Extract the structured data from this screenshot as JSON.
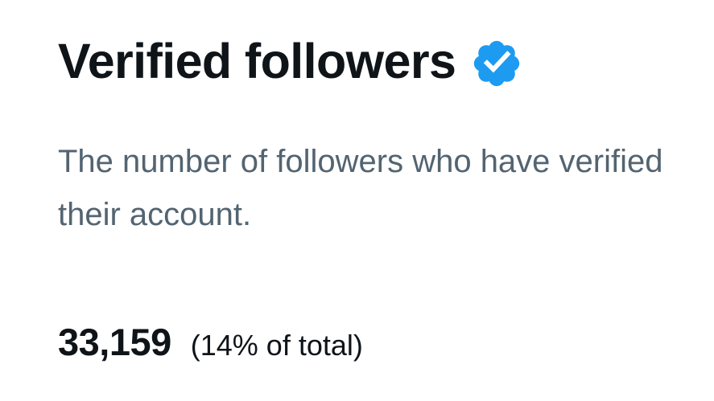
{
  "title": "Verified followers",
  "badge_icon": "verified-badge-icon",
  "badge_color": "#1d9bf0",
  "description": "The number of followers who have verified their account.",
  "stat": {
    "value": "33,159",
    "percent_text": "(14% of total)"
  }
}
